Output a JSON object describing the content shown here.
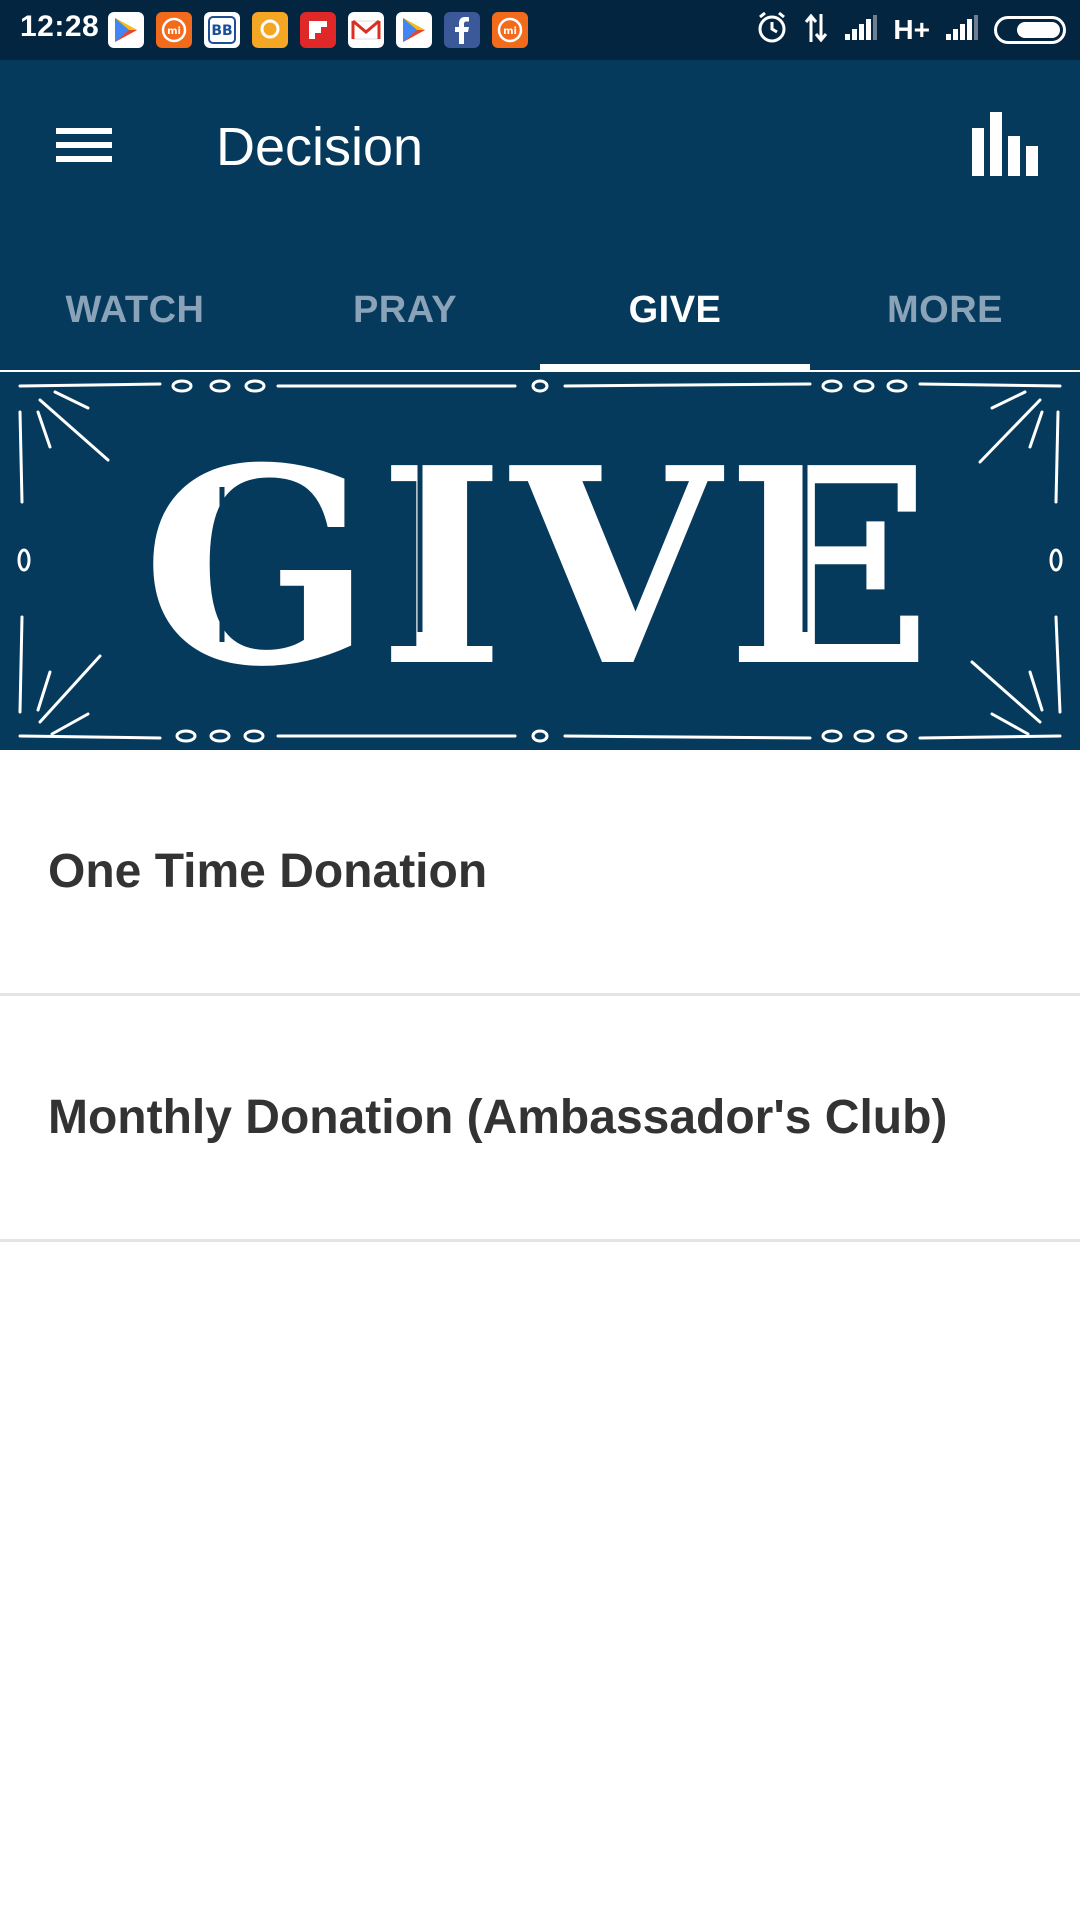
{
  "status_bar": {
    "time": "12:28",
    "network": "H+",
    "notifications": [
      {
        "icon": "play-store-icon",
        "color": "#ffffff"
      },
      {
        "icon": "mi-icon",
        "color": "#f26a1b"
      },
      {
        "icon": "bb-metro-icon",
        "color": "#ffffff"
      },
      {
        "icon": "chat-icon",
        "color": "#f5a623"
      },
      {
        "icon": "flipboard-icon",
        "color": "#e12828"
      },
      {
        "icon": "gmail-icon",
        "color": "#ffffff"
      },
      {
        "icon": "play-store-icon",
        "color": "#ffffff"
      },
      {
        "icon": "facebook-icon",
        "color": "#3b5998"
      },
      {
        "icon": "mi-icon",
        "color": "#f26a1b"
      }
    ]
  },
  "app_bar": {
    "title": "Decision",
    "menu_icon": "hamburger-menu-icon",
    "action_icon": "bar-chart-icon"
  },
  "tabs": [
    {
      "label": "WATCH",
      "active": false
    },
    {
      "label": "PRAY",
      "active": false
    },
    {
      "label": "GIVE",
      "active": true
    },
    {
      "label": "MORE",
      "active": false
    }
  ],
  "banner": {
    "text": "GIVE"
  },
  "list": {
    "items": [
      {
        "label": "One Time Donation"
      },
      {
        "label": "Monthly Donation (Ambassador's Club)"
      }
    ]
  },
  "colors": {
    "status_bar": "#04253f",
    "app_bar": "#063a5c",
    "tab_inactive": "#8ba3b8",
    "tab_active": "#ffffff",
    "list_text": "#333333",
    "divider": "#e4e4e4"
  }
}
